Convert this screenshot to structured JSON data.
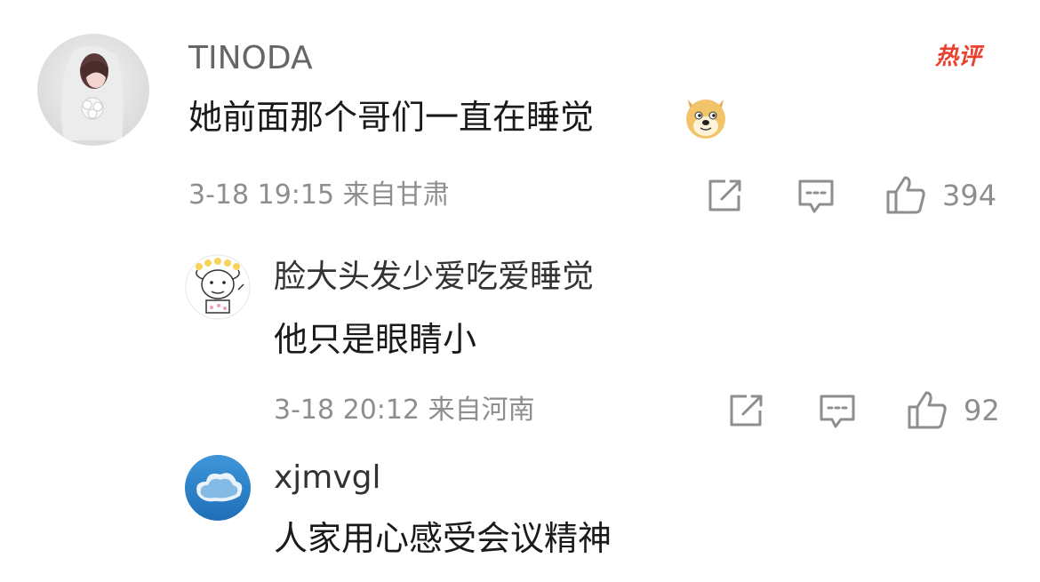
{
  "comments": [
    {
      "username": "TINODA",
      "text": "她前面那个哥们一直在睡觉",
      "emoji": "doge-emoji",
      "meta": "3-18 19:15 来自甘肃",
      "likes": "394",
      "badge": "热评"
    },
    {
      "username": "脸大头发少爱吃爱睡觉",
      "text": "他只是眼睛小",
      "meta": "3-18 20:12 来自河南",
      "likes": "92"
    },
    {
      "username": "xjmvgl",
      "text": "人家用心感受会议精神"
    }
  ],
  "colors": {
    "hot_badge": "#e8412d",
    "meta_text": "#8e8e8e",
    "body_text": "#1a1a1a"
  }
}
